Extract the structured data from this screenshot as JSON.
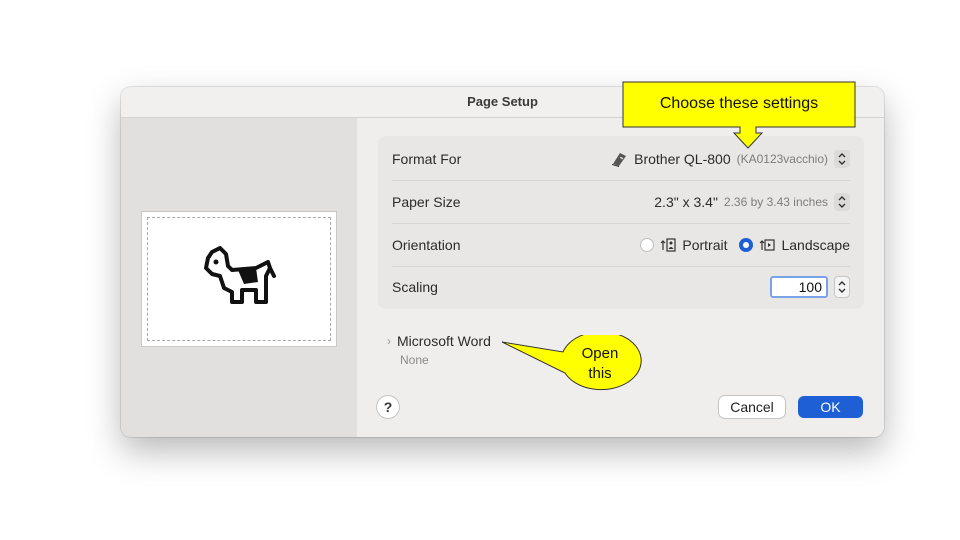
{
  "window": {
    "title": "Page Setup"
  },
  "settings": {
    "format_for": {
      "label": "Format For",
      "value": "Brother QL-800",
      "detail": "(KA0123vacchio)",
      "icon": "printer-icon"
    },
    "paper_size": {
      "label": "Paper Size",
      "value": "2.3\" x 3.4\"",
      "detail": "2.36 by 3.43 inches"
    },
    "orientation": {
      "label": "Orientation",
      "portrait": "Portrait",
      "landscape": "Landscape",
      "selected": "Landscape"
    },
    "scaling": {
      "label": "Scaling",
      "value": "100"
    }
  },
  "app_section": {
    "title": "Microsoft Word",
    "value": "None"
  },
  "buttons": {
    "help": "?",
    "cancel": "Cancel",
    "ok": "OK"
  },
  "annotations": {
    "top": "Choose these settings",
    "bottom_line1": "Open",
    "bottom_line2": "this"
  },
  "colors": {
    "accent": "#1f5fd6",
    "callout": "#ffff00"
  }
}
